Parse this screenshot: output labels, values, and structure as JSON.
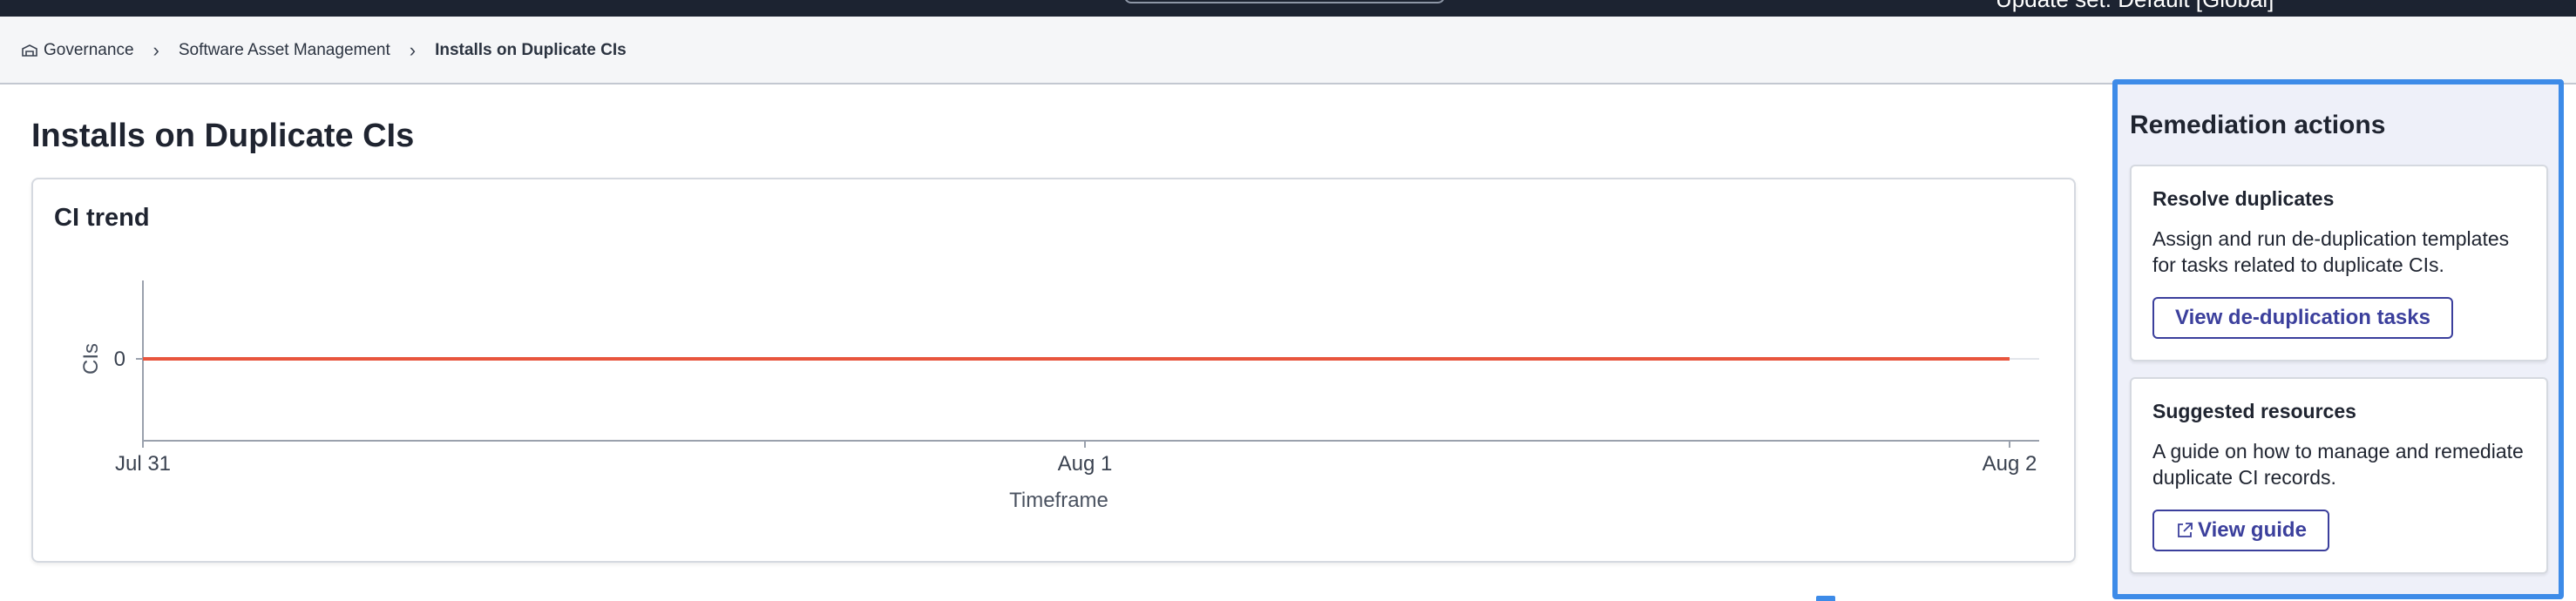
{
  "topbar": {
    "update_set": "Update set: Default [Global]"
  },
  "breadcrumb": {
    "items": [
      "Governance",
      "Software Asset Management",
      "Installs on Duplicate CIs"
    ]
  },
  "page": {
    "title": "Installs on Duplicate CIs"
  },
  "chart_card": {
    "title": "CI trend"
  },
  "chart_data": {
    "type": "line",
    "x": [
      "Jul 31",
      "Aug 1",
      "Aug 2"
    ],
    "series": [
      {
        "values": [
          0,
          0,
          0
        ],
        "color": "#e8553d"
      }
    ],
    "yticks": [
      "0"
    ],
    "xlabel": "Timeframe",
    "ylabel": "CIs",
    "grid": true
  },
  "remediation": {
    "title": "Remediation actions",
    "cards": [
      {
        "heading": "Resolve duplicates",
        "text": "Assign and run de-duplication templates for tasks related to duplicate CIs.",
        "button": "View de-duplication tasks"
      },
      {
        "heading": "Suggested resources",
        "text": "A guide on how to manage and remediate duplicate CI records.",
        "button": "View guide",
        "button_icon": "external-link-icon"
      }
    ]
  },
  "colors": {
    "accent": "#3b3f9c",
    "highlight": "#3d8be8",
    "series": "#e8553d"
  }
}
